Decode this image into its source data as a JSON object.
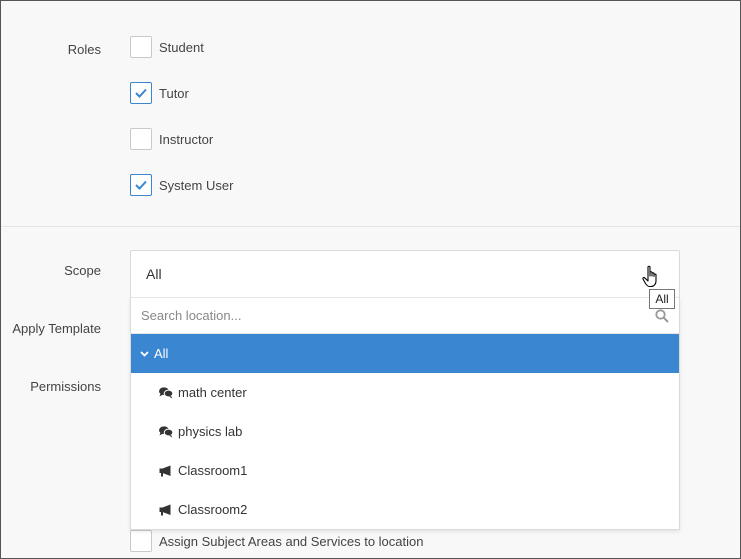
{
  "roles": {
    "label": "Roles",
    "items": [
      {
        "label": "Student",
        "checked": false
      },
      {
        "label": "Tutor",
        "checked": true
      },
      {
        "label": "Instructor",
        "checked": false
      },
      {
        "label": "System User",
        "checked": true
      }
    ]
  },
  "scope": {
    "label": "Scope",
    "value": "All",
    "tooltip": "All",
    "search_placeholder": "Search location...",
    "options": [
      {
        "label": "All",
        "icon": "chevron-down-icon",
        "selected": true
      },
      {
        "label": "math center",
        "icon": "comments-icon"
      },
      {
        "label": "physics lab",
        "icon": "comments-icon"
      },
      {
        "label": "Classroom1",
        "icon": "megaphone-icon"
      },
      {
        "label": "Classroom2",
        "icon": "megaphone-icon"
      }
    ]
  },
  "apply_template": {
    "label": "Apply Template"
  },
  "permissions": {
    "label": "Permissions",
    "assign_label": "Assign Subject Areas and Services to location"
  },
  "colors": {
    "accent": "#3a86d0"
  }
}
